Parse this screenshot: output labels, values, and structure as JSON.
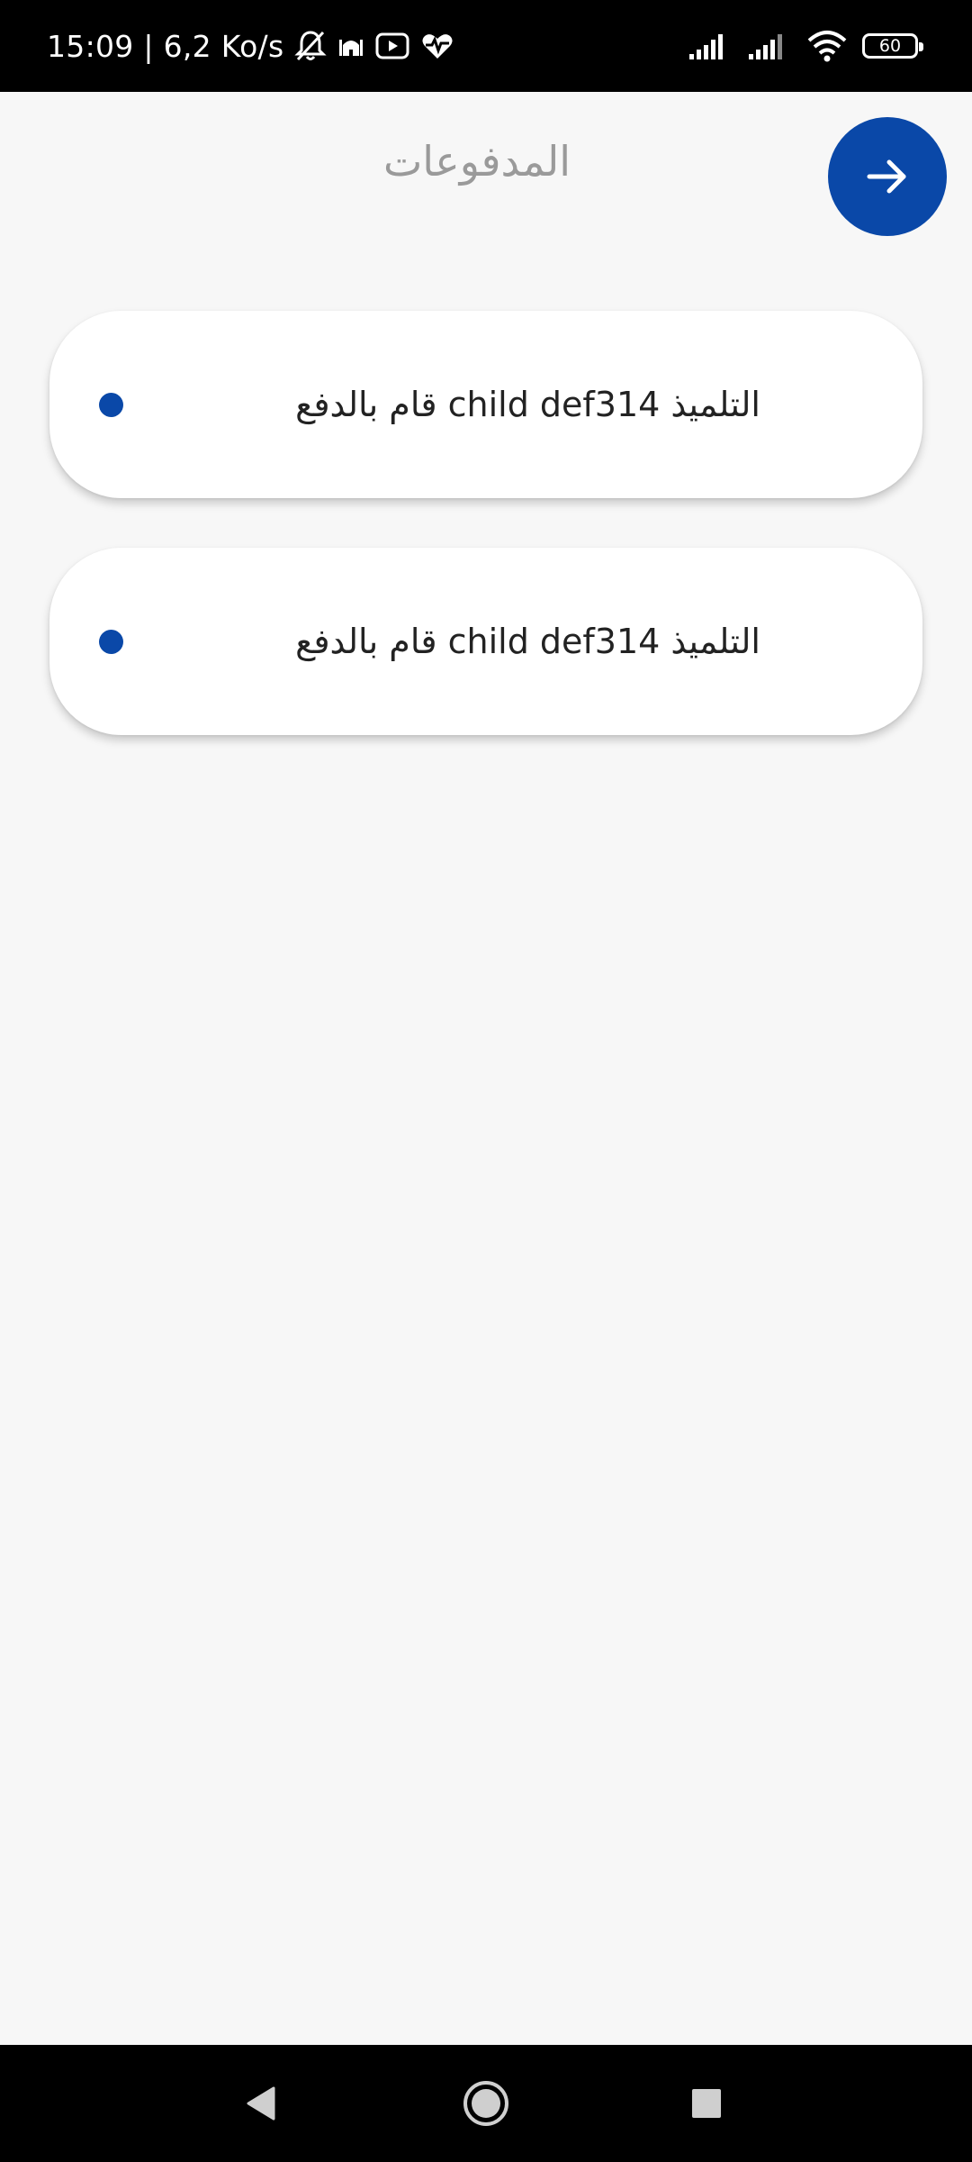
{
  "status_bar": {
    "time_speed": "15:09 | 6,2 Ko/s",
    "battery_level": "60",
    "left_icons": [
      "bell-off-icon",
      "mosque-icon",
      "youtube-icon",
      "heart-pulse-icon"
    ],
    "right_icons": [
      "signal-icon",
      "signal-icon",
      "wifi-icon",
      "battery-icon"
    ]
  },
  "header": {
    "title": "المدفوعات",
    "back_icon": "arrow-right-icon"
  },
  "payments": [
    {
      "text": "التلميذ child def314 قام بالدفع"
    },
    {
      "text": "التلميذ child def314 قام بالدفع"
    }
  ],
  "navigation": {
    "icons": [
      "back-triangle-icon",
      "home-circle-icon",
      "recent-square-icon"
    ]
  },
  "colors": {
    "accent": "#0a48a8",
    "background": "#f7f7f7",
    "card": "#ffffff",
    "title": "#9a9a9a"
  }
}
